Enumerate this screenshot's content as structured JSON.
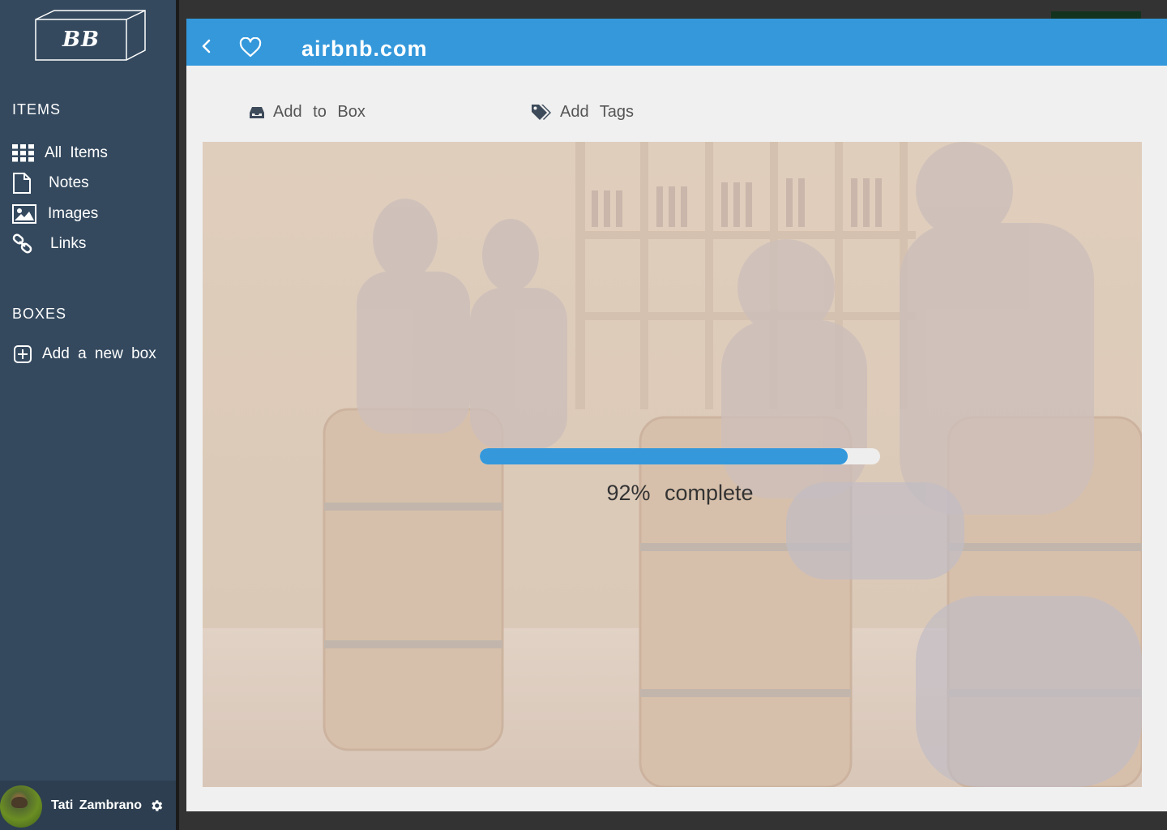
{
  "sidebar": {
    "logo_text": "BB",
    "items_section_title": "ITEMS",
    "items": [
      {
        "label": "All Items",
        "icon": "grid-icon"
      },
      {
        "label": "Notes",
        "icon": "document-icon"
      },
      {
        "label": "Images",
        "icon": "image-icon"
      },
      {
        "label": "Links",
        "icon": "link-icon"
      }
    ],
    "boxes_section_title": "BOXES",
    "add_box_label": "Add a new box",
    "user": {
      "name": "Tati Zambrano"
    }
  },
  "header": {
    "title": "airbnb.com"
  },
  "actions": {
    "add_to_box": "Add to Box",
    "add_tags": "Add Tags"
  },
  "progress": {
    "value": 0.92,
    "label": "92% complete"
  },
  "colors": {
    "sidebar_bg": "#34495e",
    "accent": "#3498db",
    "panel_bg": "#f0f0f0"
  }
}
